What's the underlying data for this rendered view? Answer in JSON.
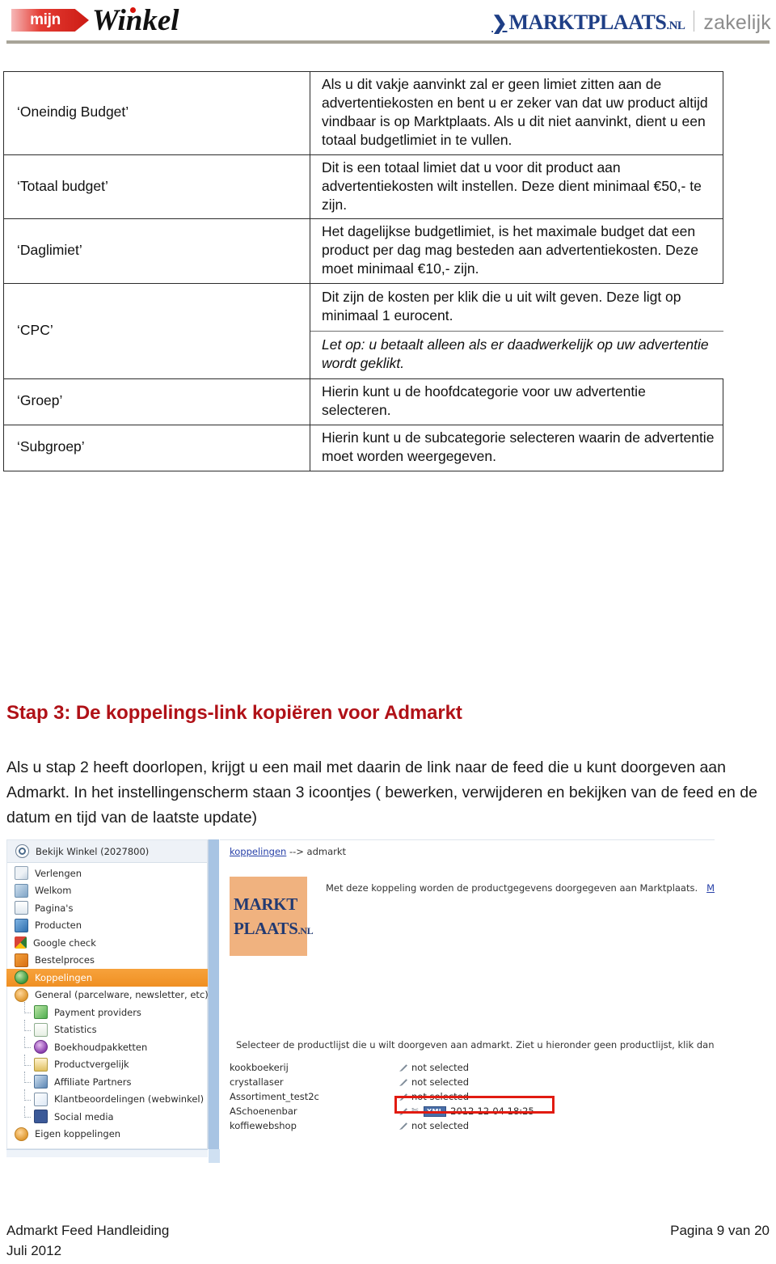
{
  "header": {
    "logo_left_badge": "mijn",
    "logo_left_word": "Winkel",
    "logo_right_arrow": "❯",
    "logo_right_name": "MARKTPLAATS",
    "logo_right_tld": ".NL",
    "logo_right_suffix": "zakelijk"
  },
  "table": {
    "rows": [
      {
        "label": "‘Oneindig Budget’",
        "description": "Als u dit vakje aanvinkt zal er geen limiet zitten aan de advertentiekosten en bent u er zeker van dat uw product altijd vindbaar is op Marktplaats. Als u dit niet aanvinkt, dient u een totaal budgetlimiet in te vullen."
      },
      {
        "label": "‘Totaal budget’",
        "description": "Dit is een totaal limiet dat u voor dit product aan advertentiekosten wilt instellen. Deze dient minimaal €50,- te zijn."
      },
      {
        "label": "‘Daglimiet’",
        "description": "Het dagelijkse budgetlimiet, is het maximale budget dat een product per dag mag besteden aan advertentiekosten. Deze moet minimaal €10,- zijn."
      },
      {
        "label": "‘CPC’",
        "description": "Dit zijn de kosten per klik die u uit wilt geven. Deze ligt op minimaal 1 eurocent.",
        "description_note": "Let op: u betaalt alleen als er daadwerkelijk op uw advertentie wordt geklikt."
      },
      {
        "label": "‘Groep’",
        "description": "Hierin kunt u de hoofdcategorie voor uw advertentie selecteren."
      },
      {
        "label": "‘Subgroep’",
        "description": "Hierin kunt u de subcategorie selecteren waarin de advertentie moet worden weergegeven."
      }
    ]
  },
  "section": {
    "heading": "Stap 3: De koppelings-link kopiëren voor Admarkt",
    "paragraph": "Als u stap 2 heeft doorlopen, krijgt u een mail met daarin de link naar de feed die u kunt doorgeven aan Admarkt.  In het instellingenscherm staan 3 icoontjes ( bewerken, verwijderen en bekijken van de feed en de datum en tijd van de laatste update)"
  },
  "screenshot": {
    "sidebar": {
      "top_item": "Bekijk Winkel (2027800)",
      "top_item_icon": "eye-icon",
      "items": [
        {
          "label": "Verlengen",
          "icon": "renew-icon",
          "child": false,
          "selected": false
        },
        {
          "label": "Welkom",
          "icon": "welcome-icon",
          "child": false,
          "selected": false
        },
        {
          "label": "Pagina's",
          "icon": "pages-icon",
          "child": false,
          "selected": false
        },
        {
          "label": "Producten",
          "icon": "products-icon",
          "child": false,
          "selected": false
        },
        {
          "label": "Google check",
          "icon": "google-icon",
          "child": false,
          "selected": false
        },
        {
          "label": "Bestelproces",
          "icon": "order-icon",
          "child": false,
          "selected": false
        },
        {
          "label": "Koppelingen",
          "icon": "links-icon",
          "child": false,
          "selected": true
        },
        {
          "label": "General (parcelware, newsletter, etc)",
          "icon": "general-icon",
          "child": false,
          "selected": false
        },
        {
          "label": "Payment providers",
          "icon": "payment-icon",
          "child": true,
          "selected": false
        },
        {
          "label": "Statistics",
          "icon": "statistics-icon",
          "child": true,
          "selected": false
        },
        {
          "label": "Boekhoudpakketten",
          "icon": "accounting-icon",
          "child": true,
          "selected": false
        },
        {
          "label": "Productvergelijk",
          "icon": "compare-icon",
          "child": true,
          "selected": false
        },
        {
          "label": "Affiliate Partners",
          "icon": "affiliate-icon",
          "child": true,
          "selected": false
        },
        {
          "label": "Klantbeoordelingen (webwinkel)",
          "icon": "reviews-icon",
          "child": true,
          "selected": false
        },
        {
          "label": "Social media",
          "icon": "facebook-icon",
          "child": true,
          "selected": false
        },
        {
          "label": "Eigen koppelingen",
          "icon": "own-links-icon",
          "child": false,
          "selected": false
        }
      ]
    },
    "main": {
      "breadcrumb_link": "koppelingen",
      "breadcrumb_rest": " --> admarkt",
      "logo_line1": "MARKT",
      "logo_line2": "PLAATS",
      "logo_tld": ".NL",
      "description": "Met deze koppeling worden de productgegevens doorgegeven aan Marktplaats.",
      "description_link": "Meer info over M",
      "select_hint": "Selecteer de productlijst die u wilt doorgeven aan admarkt. Ziet u hieronder geen productlijst, klik dan op Help",
      "not_selected_text": "not selected",
      "xml_badge": "XML",
      "feeds": [
        {
          "name": "kookboekerij",
          "status": "not selected",
          "has_feed": false
        },
        {
          "name": "crystallaser",
          "status": "not selected",
          "has_feed": false
        },
        {
          "name": "Assortiment_test2c",
          "status": "not selected",
          "has_feed": false
        },
        {
          "name": "ASchoenenbar",
          "status": "2012-12-04 18:25",
          "has_feed": true
        },
        {
          "name": "koffiewebshop",
          "status": "not selected",
          "has_feed": false
        }
      ]
    }
  },
  "footer": {
    "left_line1": "Admarkt Feed Handleiding",
    "left_line2": "Juli 2012",
    "right": "Pagina 9 van 20"
  }
}
